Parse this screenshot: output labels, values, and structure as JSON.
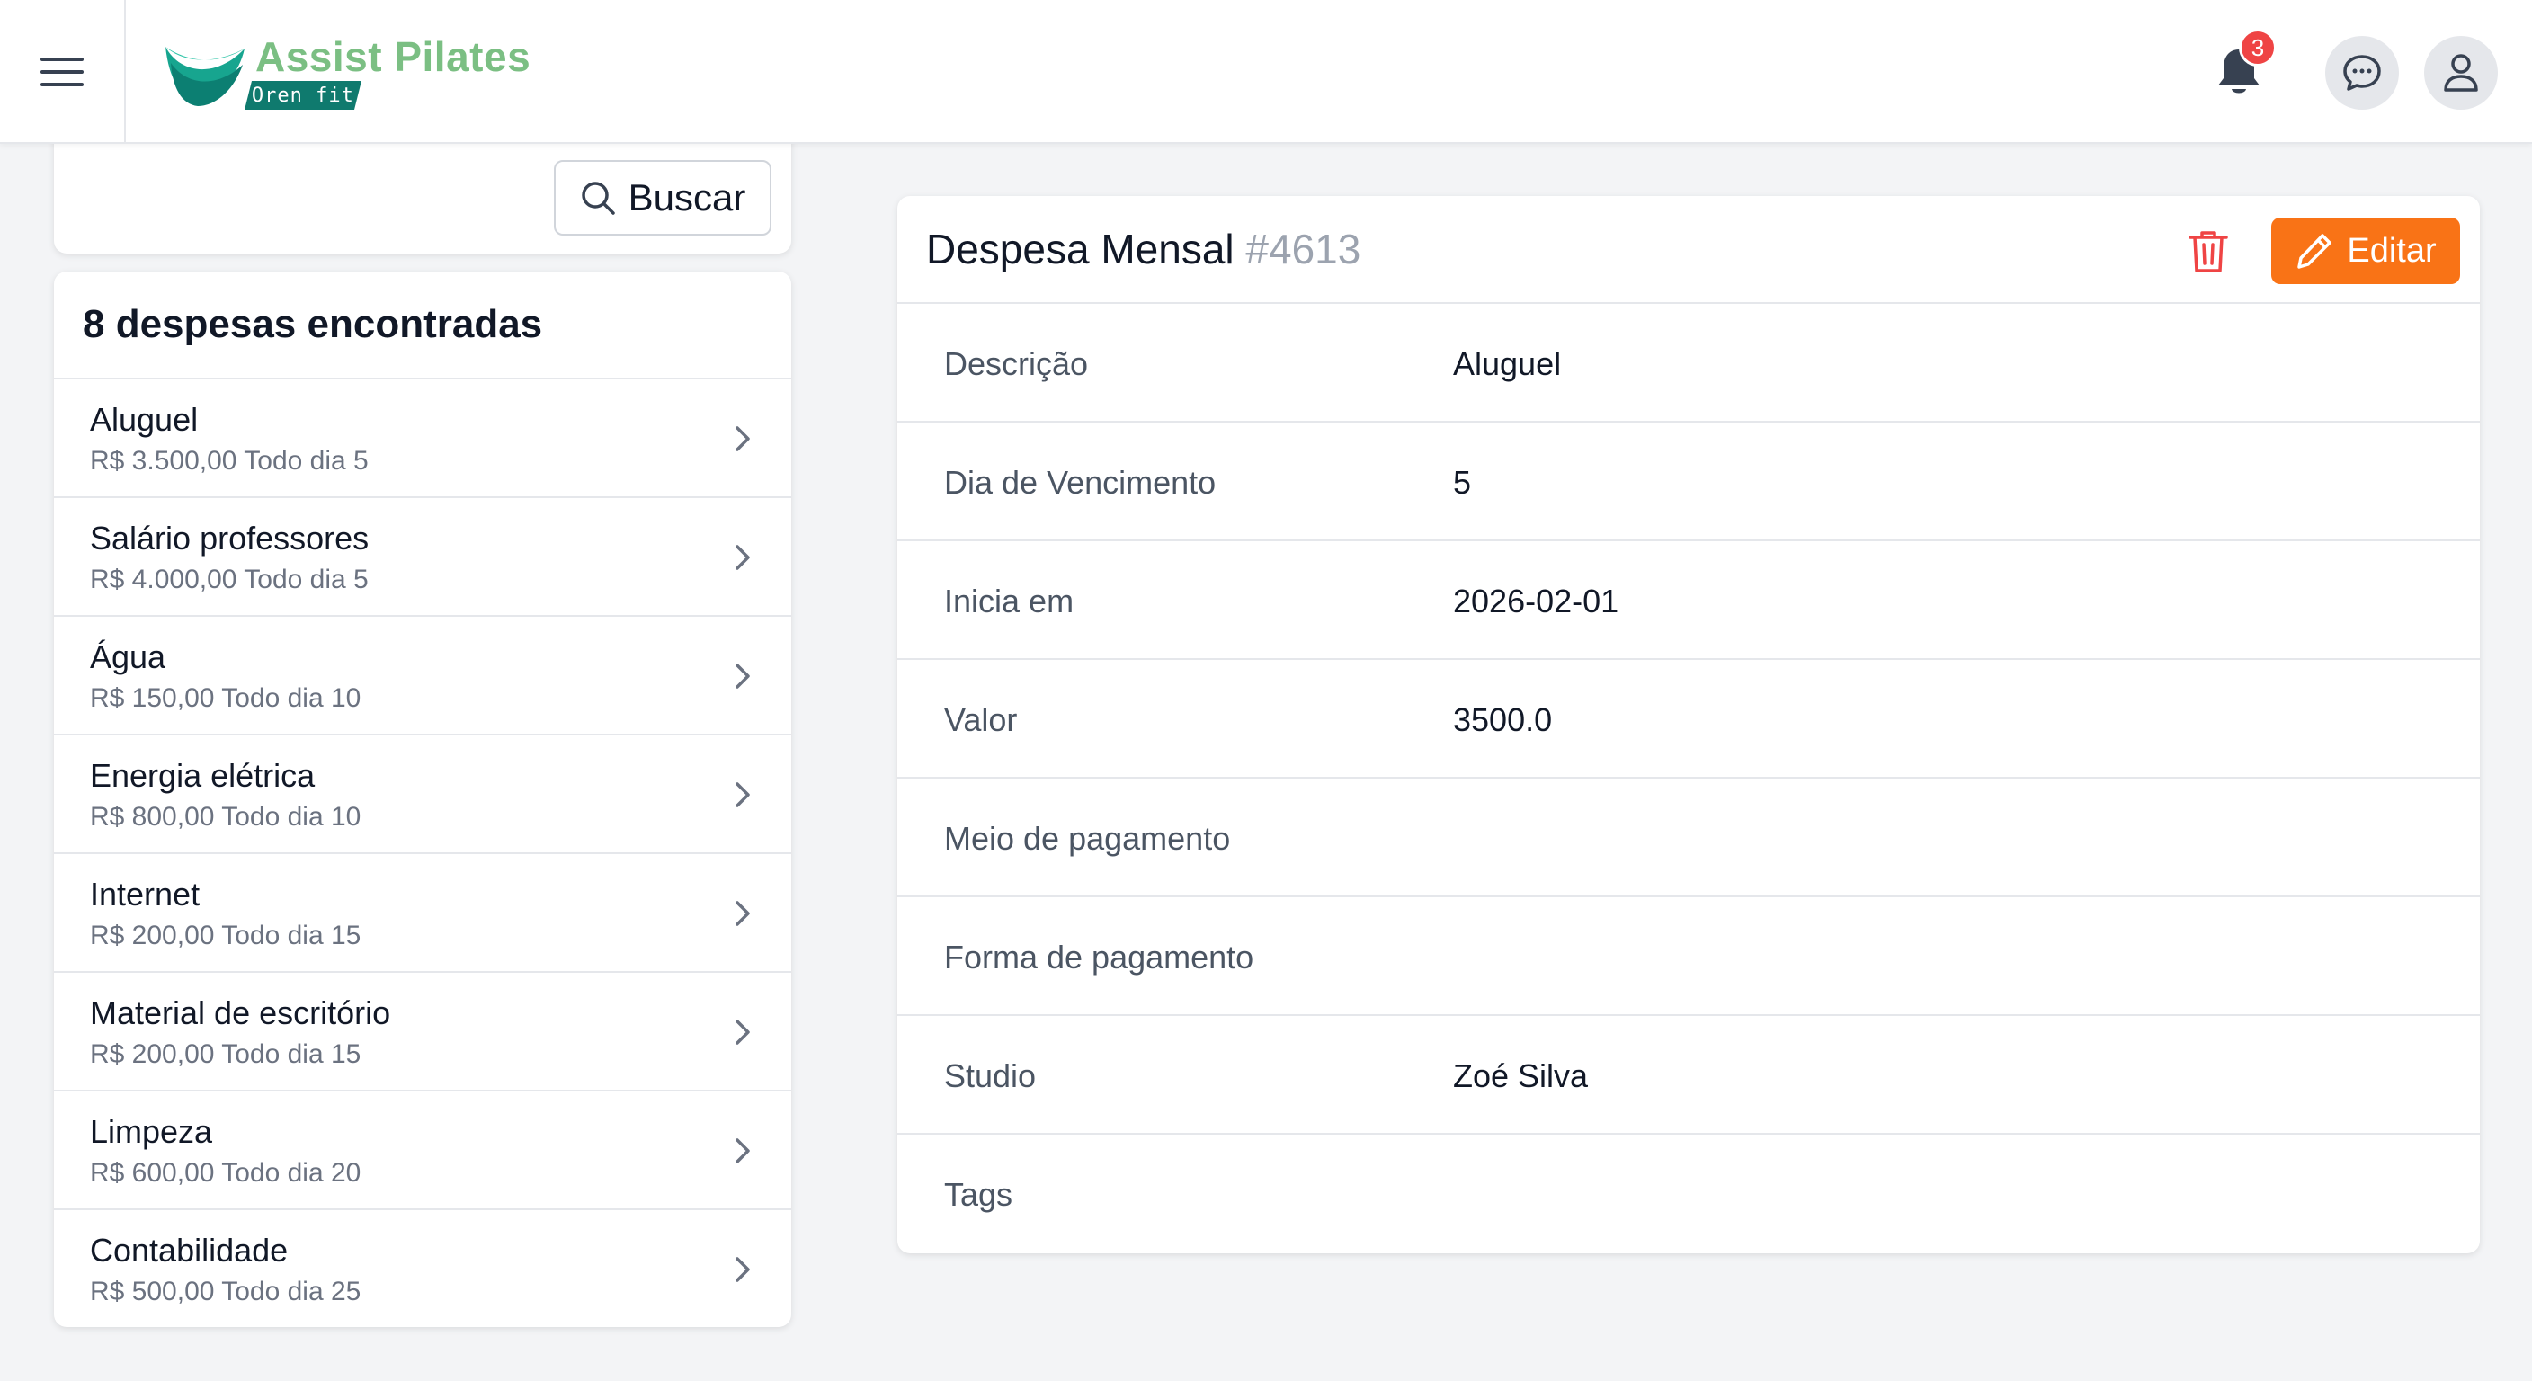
{
  "header": {
    "app_name": "Assist Pilates",
    "app_sub": "Oren fit",
    "notification_count": "3"
  },
  "search": {
    "button_label": "Buscar"
  },
  "list": {
    "count_label": "8 despesas encontradas",
    "items": [
      {
        "title": "Aluguel",
        "subtitle": "R$ 3.500,00 Todo dia 5"
      },
      {
        "title": "Salário professores",
        "subtitle": "R$ 4.000,00 Todo dia 5"
      },
      {
        "title": "Água",
        "subtitle": "R$ 150,00 Todo dia 10"
      },
      {
        "title": "Energia elétrica",
        "subtitle": "R$ 800,00 Todo dia 10"
      },
      {
        "title": "Internet",
        "subtitle": "R$ 200,00 Todo dia 15"
      },
      {
        "title": "Material de escritório",
        "subtitle": "R$ 200,00 Todo dia 15"
      },
      {
        "title": "Limpeza",
        "subtitle": "R$ 600,00 Todo dia 20"
      },
      {
        "title": "Contabilidade",
        "subtitle": "R$ 500,00 Todo dia 25"
      }
    ]
  },
  "detail": {
    "title": "Despesa Mensal",
    "number": "#4613",
    "edit_label": "Editar",
    "rows": [
      {
        "label": "Descrição",
        "value": "Aluguel"
      },
      {
        "label": "Dia de Vencimento",
        "value": "5"
      },
      {
        "label": "Inicia em",
        "value": "2026-02-01"
      },
      {
        "label": "Valor",
        "value": "3500.0"
      },
      {
        "label": "Meio de pagamento",
        "value": ""
      },
      {
        "label": "Forma de pagamento",
        "value": ""
      },
      {
        "label": "Studio",
        "value": "Zoé Silva"
      },
      {
        "label": "Tags",
        "value": ""
      }
    ]
  },
  "colors": {
    "accent": "#f97316",
    "danger": "#ef4444",
    "logo_green": "#7bbf83",
    "logo_teal": "#0f7a6e"
  },
  "icons": [
    "menu-icon",
    "logo-icon",
    "bell-icon",
    "chat-icon",
    "user-icon",
    "search-icon",
    "chevron-right-icon",
    "trash-icon",
    "pencil-icon"
  ]
}
